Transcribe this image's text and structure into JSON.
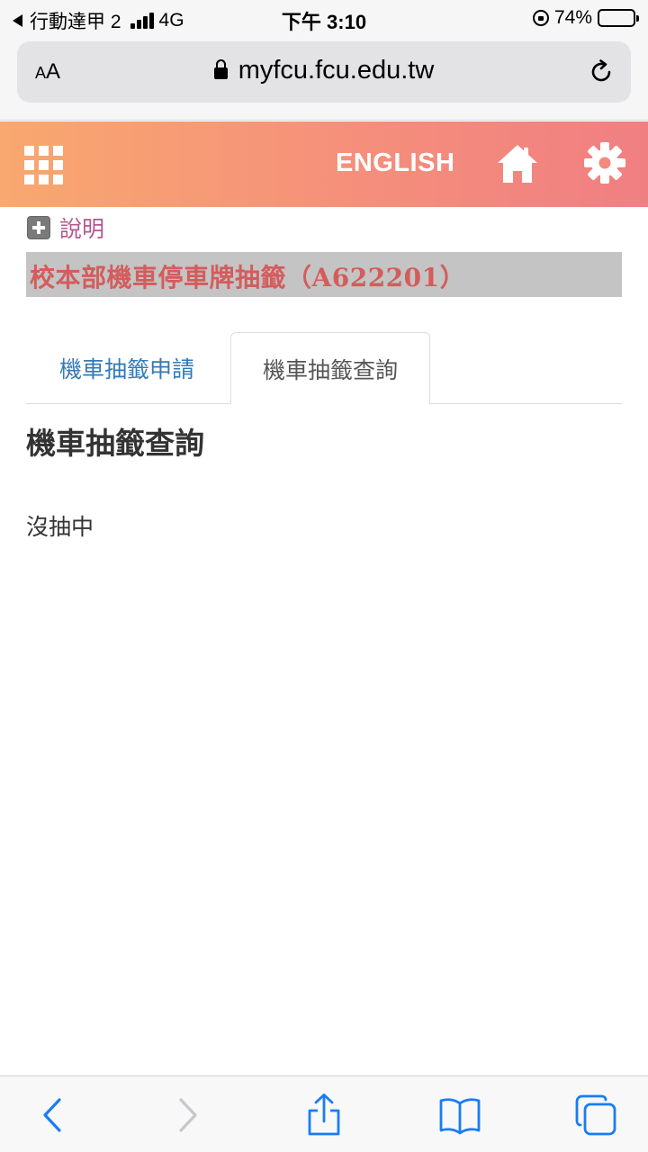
{
  "status_bar": {
    "carrier": "行動達甲 2",
    "network": "4G",
    "time": "下午 3:10",
    "battery": "74%",
    "battery_level": 0.74
  },
  "browser": {
    "text_size_label_small": "A",
    "text_size_label_large": "A",
    "url": "myfcu.fcu.edu.tw"
  },
  "header": {
    "language_link": "ENGLISH",
    "gradient_start": "#f9a86f",
    "gradient_end": "#f07f82"
  },
  "content": {
    "explain_label": "說明",
    "page_title": "校本部機車停車牌抽籤（A622201）",
    "tabs": [
      {
        "label": "機車抽籤申請",
        "active": false
      },
      {
        "label": "機車抽籤查詢",
        "active": true
      }
    ],
    "section_heading": "機車抽籤查詢",
    "result": "沒抽中"
  },
  "toolbar": {
    "icons": [
      "back-icon",
      "forward-icon",
      "share-icon",
      "bookmarks-icon",
      "tabs-icon"
    ]
  },
  "colors": {
    "accent_link": "#337ab7",
    "title_red": "#d45c5c",
    "explain_pink": "#b4588e",
    "ios_blue": "#1a7cf5"
  }
}
